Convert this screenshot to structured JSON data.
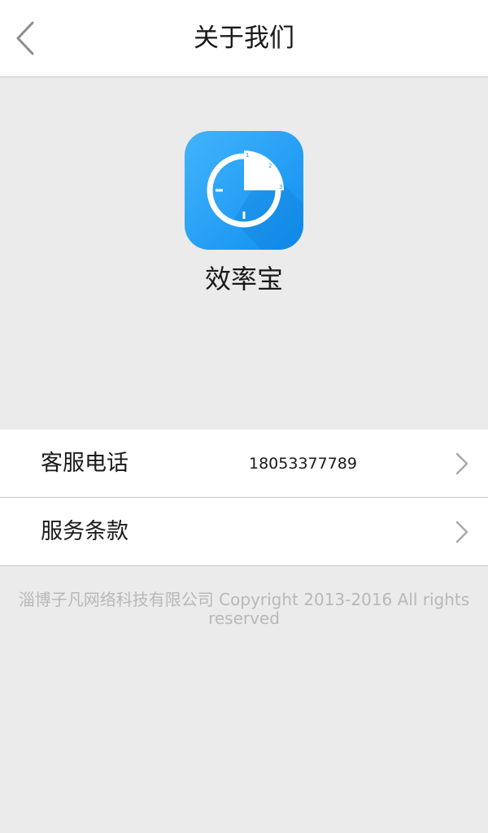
{
  "header": {
    "title": "关于我们",
    "back_icon": "chevron-left-icon"
  },
  "app": {
    "name": "效率宝",
    "logo_icon": "clock-app-icon",
    "logo_color": "#1e9cf5"
  },
  "settings": {
    "items": [
      {
        "label": "客服电话",
        "value": "18053377789",
        "icon": "chevron-right-icon"
      },
      {
        "label": "服务条款",
        "icon": "chevron-right-icon"
      }
    ]
  },
  "footer": {
    "copyright": "淄博子凡网络科技有限公司 Copyright 2013-2016 All rights reserved"
  }
}
